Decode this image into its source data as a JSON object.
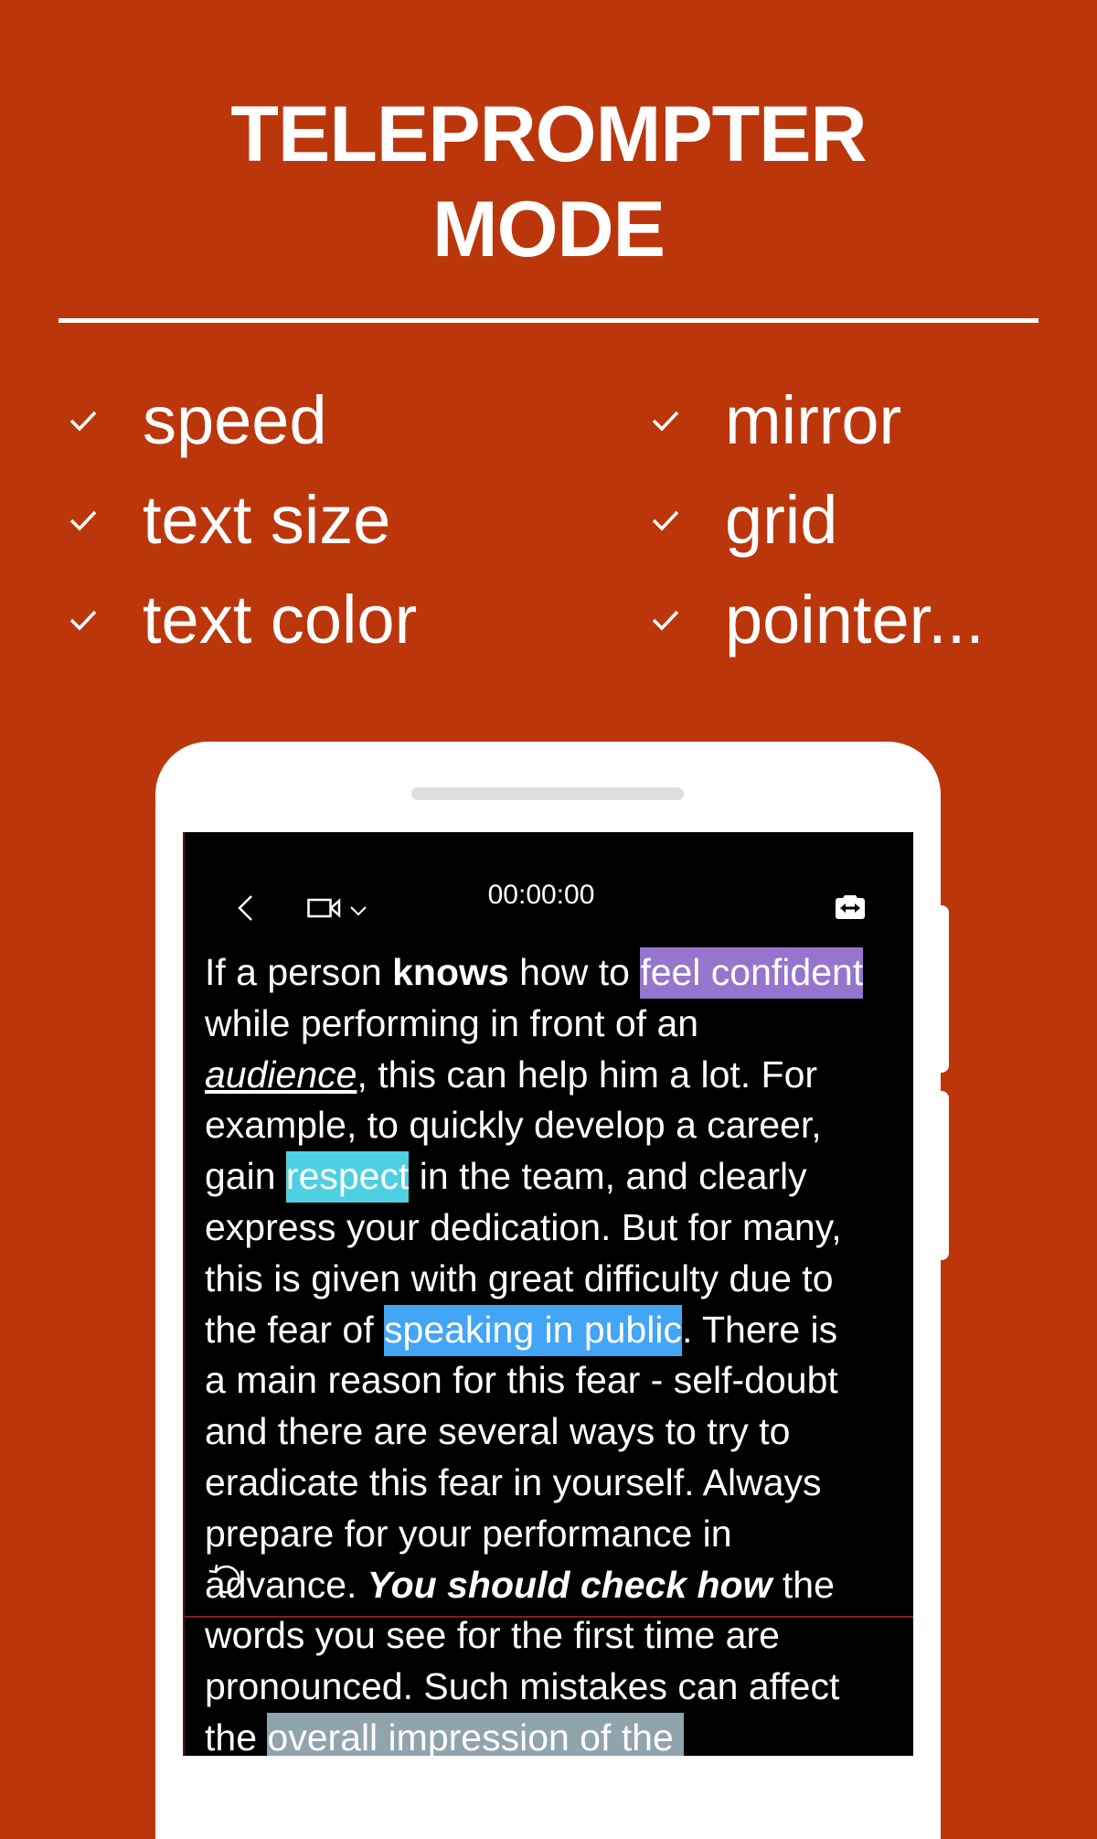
{
  "header": {
    "title_line1": "TELEPROMPTER",
    "title_line2": "MODE"
  },
  "features": {
    "left": [
      {
        "icon": "check-icon",
        "label": "speed"
      },
      {
        "icon": "check-icon",
        "label": "text size"
      },
      {
        "icon": "check-icon",
        "label": "text color"
      }
    ],
    "right": [
      {
        "icon": "check-icon",
        "label": "mirror"
      },
      {
        "icon": "check-icon",
        "label": "grid"
      },
      {
        "icon": "check-icon",
        "label": "pointer..."
      }
    ]
  },
  "colors": {
    "background": "#BC360C",
    "highlight_purple": "#9575CD",
    "highlight_cyan": "#4DD0E1",
    "highlight_blue": "#42A5F5",
    "highlight_gray": "#90A4AE",
    "pointer_line": "#8B1A1A"
  },
  "phone": {
    "toolbar": {
      "back_icon": "chevron-left-icon",
      "camera_icon": "video-camera-icon",
      "camera_dropdown_icon": "chevron-down-icon",
      "timer": "00:00:00",
      "flip_icon": "camera-flip-icon"
    },
    "rotate_icon": "rotate-icon",
    "script": {
      "l1_a": "If a person ",
      "l1_b": "knows",
      "l1_c": " how to ",
      "l1_d": "feel confident",
      "l2": "while performing in front of an",
      "l3_a": "audience",
      "l3_b": ", this can help him a lot. For",
      "l4": "example, to quickly develop a career,",
      "l5_a": "gain ",
      "l5_b": "respect",
      "l5_c": " in the team, and clearly",
      "l6": "express your dedication. But for many,",
      "l7": "this is given with great difficulty due to",
      "l8_a": "the fear of ",
      "l8_b": "speaking in public",
      "l8_c": ". There is",
      "l9": "a main reason for this fear - self-doubt",
      "l10": "and there are several ways to try to",
      "l11": "eradicate this fear in yourself. Always",
      "l12": "prepare for your performance in",
      "l13_a": "advance. ",
      "l13_b": "You should check how",
      "l13_c": " the",
      "l14": "words you see for the first time are",
      "l15": "pronounced. Such mistakes can affect",
      "l16_a": "the ",
      "l16_b": "overall impression of the "
    }
  }
}
